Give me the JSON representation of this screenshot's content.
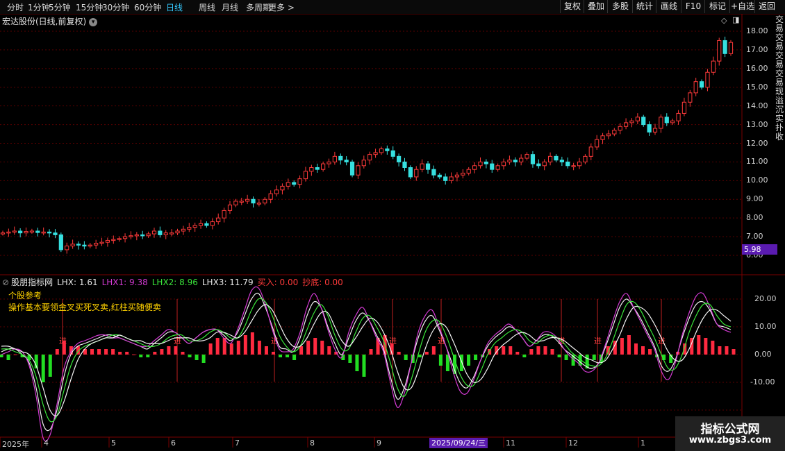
{
  "toolbar": {
    "periods": [
      "分时",
      "1分钟",
      "5分钟",
      "15分钟",
      "30分钟",
      "60分钟",
      "日线",
      "周线",
      "月线",
      "多周期",
      "更多 >"
    ],
    "active": "日线",
    "right_buttons": [
      "复权",
      "叠加",
      "多股",
      "统计",
      "画线",
      "F10",
      "标记",
      "+自选",
      "返回"
    ]
  },
  "header": {
    "title": "宏达股份(日线,前复权)"
  },
  "price_axis": {
    "ticks": [
      "18.00",
      "17.00",
      "16.00",
      "15.00",
      "14.00",
      "13.00",
      "12.00",
      "11.00",
      "10.00",
      "9.00",
      "8.00",
      "7.00",
      "6.00"
    ],
    "current": "5.98"
  },
  "indicator": {
    "name": "股朋指标网",
    "values": [
      {
        "text": "LHX: 1.61",
        "color": "#e8e8e8"
      },
      {
        "text": "LHX1: 9.38",
        "color": "#d23ad2"
      },
      {
        "text": "LHX2: 8.96",
        "color": "#3ae63a"
      },
      {
        "text": "LHX3: 11.79",
        "color": "#e8e8e8"
      },
      {
        "text": "买入: 0.00",
        "color": "#ff3a3a"
      },
      {
        "text": "抄底: 0.00",
        "color": "#ff3a3a"
      }
    ],
    "notes": [
      "个股参考",
      "操作基本要领金叉买死叉卖,红柱买随便卖"
    ],
    "axis_ticks": [
      "20.00",
      "10.00",
      "0.00",
      "-10.00"
    ],
    "signal_label": "进"
  },
  "dates": {
    "labels": [
      "2025年",
      "4",
      "5",
      "6",
      "7",
      "8",
      "9",
      "11",
      "12",
      "1"
    ],
    "highlight": "2025/09/24/三"
  },
  "side_strip": "交易交易交易交易现溢沉实扑收",
  "watermark": {
    "line1": "指标公式网",
    "line2": "www.zbgs3.com"
  },
  "colors": {
    "up": "#ff3a3a",
    "down": "#36e0e0",
    "bar_up": "#ff2a40",
    "bar_down": "#22dd22",
    "grid": "#5a0000"
  },
  "chart_data": [
    {
      "type": "candlestick",
      "title": "宏达股份(日线,前复权)",
      "ylim": [
        5.5,
        18.5
      ],
      "close": [
        7.2,
        7.25,
        7.3,
        7.2,
        7.28,
        7.3,
        7.22,
        7.25,
        7.2,
        7.1,
        6.3,
        6.5,
        6.6,
        6.55,
        6.5,
        6.55,
        6.65,
        6.7,
        6.8,
        6.85,
        6.9,
        7.0,
        7.05,
        7.1,
        7.05,
        7.15,
        7.3,
        7.1,
        7.2,
        7.2,
        7.3,
        7.4,
        7.5,
        7.6,
        7.7,
        7.6,
        7.8,
        8.0,
        8.4,
        8.7,
        8.9,
        8.9,
        9.0,
        8.8,
        8.8,
        9.0,
        9.3,
        9.5,
        9.7,
        9.9,
        9.8,
        10.1,
        10.5,
        10.7,
        10.6,
        10.9,
        11.0,
        11.3,
        11.1,
        11.0,
        10.3,
        10.8,
        11.1,
        11.4,
        11.5,
        11.7,
        11.6,
        11.3,
        11.0,
        10.7,
        10.2,
        10.6,
        10.9,
        10.6,
        10.3,
        10.2,
        10.0,
        10.2,
        10.3,
        10.4,
        10.6,
        10.8,
        11.0,
        10.9,
        10.6,
        10.8,
        11.0,
        11.1,
        11.0,
        11.2,
        11.4,
        10.9,
        10.8,
        11.0,
        11.3,
        11.1,
        11.0,
        10.8,
        10.8,
        11.0,
        11.3,
        11.8,
        12.2,
        12.4,
        12.5,
        12.7,
        12.9,
        13.1,
        13.2,
        13.4,
        13.0,
        12.6,
        12.8,
        13.4,
        13.1,
        13.2,
        13.6,
        14.2,
        14.7,
        15.3,
        15.0,
        15.8,
        16.4,
        17.5,
        16.8,
        17.4
      ]
    },
    {
      "type": "line",
      "title": "股朋指标网",
      "ylim": [
        -30,
        25
      ],
      "series": [
        {
          "name": "LHX",
          "values": [
            1,
            2,
            2,
            0,
            -3,
            -12,
            -25,
            -27,
            -20,
            -8,
            0,
            3,
            4,
            5,
            6,
            7,
            7,
            6,
            5,
            4,
            3,
            2,
            4,
            6,
            8,
            8,
            6,
            4,
            6,
            8,
            9,
            9,
            7,
            5,
            8,
            14,
            20,
            22,
            17,
            10,
            3,
            2,
            1,
            6,
            14,
            19,
            17,
            10,
            4,
            0,
            6,
            12,
            15,
            12,
            7,
            2,
            -8,
            -16,
            -12,
            -3,
            6,
            12,
            14,
            9,
            3,
            -4,
            -10,
            -12,
            -8,
            -2,
            3,
            6,
            8,
            10,
            9,
            6,
            3,
            5,
            7,
            7,
            5,
            2,
            0,
            -2,
            -4,
            -5,
            -3,
            3,
            10,
            17,
            20,
            17,
            13,
            8,
            3,
            -4,
            -6,
            -2,
            6,
            13,
            18,
            19,
            16,
            11,
            10,
            9
          ]
        },
        {
          "name": "LHX1",
          "values": [
            0,
            1,
            2,
            1,
            -4,
            -15,
            -30,
            -29,
            -18,
            -5,
            1,
            4,
            5,
            6,
            7,
            7,
            6,
            6,
            5,
            4,
            3,
            3,
            5,
            7,
            9,
            8,
            6,
            4,
            6,
            8,
            9,
            9,
            6,
            4,
            9,
            16,
            23,
            24,
            18,
            9,
            2,
            1,
            2,
            8,
            17,
            22,
            17,
            9,
            2,
            -1,
            8,
            14,
            17,
            12,
            6,
            1,
            -10,
            -19,
            -14,
            -3,
            8,
            14,
            16,
            10,
            3,
            -6,
            -13,
            -14,
            -9,
            -2,
            4,
            7,
            9,
            11,
            9,
            6,
            3,
            5,
            8,
            8,
            6,
            2,
            -1,
            -3,
            -6,
            -6,
            -3,
            4,
            12,
            19,
            22,
            17,
            12,
            7,
            2,
            -6,
            -9,
            -3,
            7,
            15,
            21,
            22,
            17,
            11,
            9,
            8
          ]
        },
        {
          "name": "LHX2",
          "values": [
            2,
            2,
            1,
            0,
            -2,
            -8,
            -18,
            -24,
            -22,
            -13,
            -4,
            1,
            3,
            4,
            5,
            6,
            7,
            7,
            6,
            5,
            4,
            3,
            3,
            4,
            6,
            7,
            7,
            5,
            5,
            6,
            8,
            9,
            8,
            6,
            6,
            10,
            16,
            20,
            19,
            14,
            7,
            3,
            1,
            3,
            9,
            15,
            18,
            14,
            7,
            2,
            2,
            8,
            13,
            14,
            10,
            5,
            -3,
            -12,
            -15,
            -9,
            0,
            8,
            12,
            12,
            7,
            0,
            -7,
            -11,
            -11,
            -6,
            0,
            4,
            6,
            8,
            9,
            8,
            5,
            4,
            6,
            7,
            6,
            4,
            1,
            -1,
            -3,
            -4,
            -4,
            -1,
            5,
            12,
            18,
            19,
            16,
            11,
            6,
            0,
            -5,
            -5,
            0,
            8,
            14,
            18,
            18,
            14,
            11,
            10
          ]
        },
        {
          "name": "LHX3",
          "values": [
            3,
            3,
            2,
            1,
            0,
            -4,
            -12,
            -20,
            -22,
            -17,
            -9,
            -2,
            2,
            4,
            5,
            6,
            6,
            7,
            6,
            5,
            5,
            4,
            4,
            4,
            5,
            6,
            6,
            6,
            5,
            5,
            6,
            8,
            8,
            7,
            6,
            8,
            12,
            16,
            18,
            16,
            11,
            6,
            3,
            3,
            6,
            11,
            15,
            15,
            10,
            5,
            3,
            6,
            10,
            13,
            12,
            8,
            2,
            -6,
            -12,
            -12,
            -6,
            2,
            8,
            11,
            10,
            5,
            -1,
            -7,
            -10,
            -9,
            -5,
            0,
            3,
            5,
            7,
            8,
            7,
            5,
            5,
            6,
            6,
            5,
            3,
            1,
            -1,
            -2,
            -3,
            -2,
            2,
            7,
            13,
            17,
            17,
            15,
            11,
            6,
            1,
            -2,
            -2,
            2,
            8,
            13,
            16,
            16,
            14,
            12
          ]
        },
        {
          "name": "bars",
          "values": [
            -1,
            -2,
            0,
            -1,
            -2,
            -5,
            -10,
            -8,
            2,
            5,
            3,
            3,
            2,
            2,
            2,
            2,
            2,
            1,
            1,
            0,
            -1,
            -1,
            1,
            2,
            3,
            3,
            1,
            -1,
            -2,
            -3,
            4,
            6,
            6,
            4,
            5,
            7,
            8,
            5,
            3,
            1,
            -1,
            -1,
            -2,
            3,
            5,
            6,
            5,
            3,
            1,
            -2,
            -3,
            -6,
            -8,
            2,
            6,
            7,
            4,
            1,
            -2,
            -3,
            -1,
            1,
            3,
            -4,
            -6,
            -7,
            -6,
            -4,
            -2,
            -1,
            2,
            3,
            3,
            3,
            1,
            -1,
            2,
            3,
            3,
            2,
            -1,
            -2,
            -4,
            -4,
            -5,
            -2,
            -3,
            3,
            5,
            6,
            7,
            4,
            3,
            2,
            -1,
            -2,
            -3,
            1,
            4,
            6,
            7,
            6,
            5,
            3,
            3,
            2
          ]
        }
      ]
    }
  ]
}
